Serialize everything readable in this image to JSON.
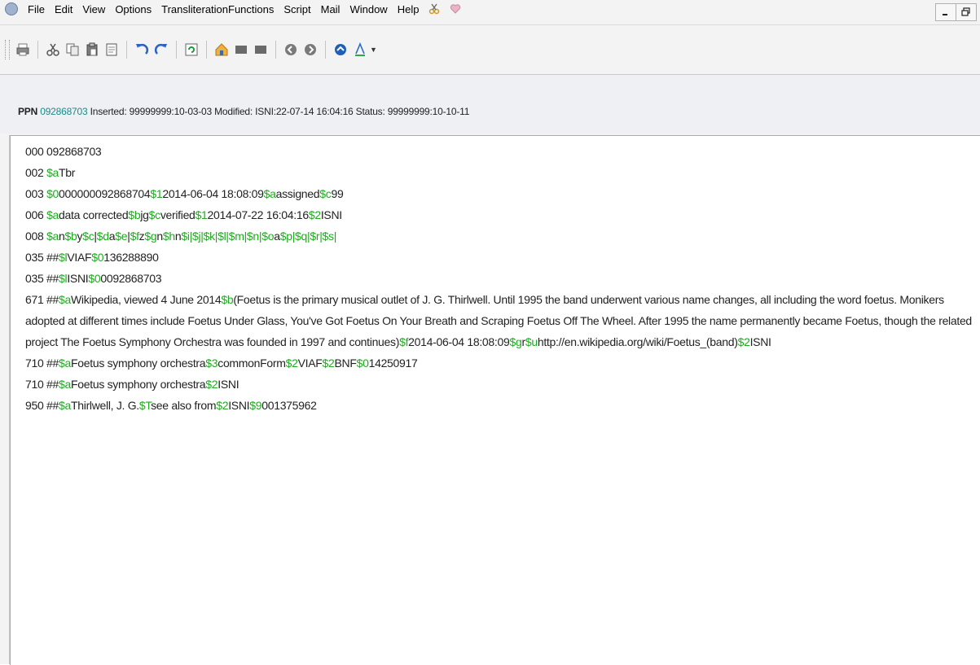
{
  "menubar": {
    "items": [
      "File",
      "Edit",
      "View",
      "Options",
      "TransliterationFunctions",
      "Script",
      "Mail",
      "Window",
      "Help"
    ]
  },
  "window_controls": [
    "minimize-icon",
    "restore-icon"
  ],
  "toolbar": {
    "icons": [
      "print-icon",
      "cut-icon",
      "copy-icon",
      "paste-icon",
      "document-icon",
      "undo-icon",
      "redo-icon",
      "refresh-icon",
      "home-icon",
      "block-icon",
      "block-icon",
      "back-icon",
      "forward-icon",
      "up-icon",
      "font-color-icon"
    ]
  },
  "header": {
    "ppn_label": "PPN",
    "ppn_value": "092868703",
    "rest": " Inserted: 99999999:10-03-03 Modified: ISNI:22-07-14 16:04:16 Status: 99999999:10-10-11"
  },
  "colors": {
    "subfield": "#1faa1f",
    "ppn": "#1c8a8a"
  },
  "record": {
    "lines": [
      {
        "segments": [
          {
            "t": "000 092868703",
            "c": "n"
          }
        ]
      },
      {
        "segments": [
          {
            "t": "002 ",
            "c": "n"
          },
          {
            "t": "$a",
            "c": "s"
          },
          {
            "t": "Tbr",
            "c": "n"
          }
        ]
      },
      {
        "segments": [
          {
            "t": "003 ",
            "c": "n"
          },
          {
            "t": "$0",
            "c": "s"
          },
          {
            "t": "000000092868704",
            "c": "n"
          },
          {
            "t": "$1",
            "c": "s"
          },
          {
            "t": "2014-06-04 18:08:09",
            "c": "n"
          },
          {
            "t": "$a",
            "c": "s"
          },
          {
            "t": "assigned",
            "c": "n"
          },
          {
            "t": "$c",
            "c": "s"
          },
          {
            "t": "99",
            "c": "n"
          }
        ]
      },
      {
        "segments": [
          {
            "t": "006 ",
            "c": "n"
          },
          {
            "t": "$a",
            "c": "s"
          },
          {
            "t": "data corrected",
            "c": "n"
          },
          {
            "t": "$b",
            "c": "s"
          },
          {
            "t": "jg",
            "c": "n"
          },
          {
            "t": "$c",
            "c": "s"
          },
          {
            "t": "verified",
            "c": "n"
          },
          {
            "t": "$1",
            "c": "s"
          },
          {
            "t": "2014-07-22 16:04:16",
            "c": "n"
          },
          {
            "t": "$2",
            "c": "s"
          },
          {
            "t": "ISNI",
            "c": "n"
          }
        ]
      },
      {
        "segments": [
          {
            "t": "008 ",
            "c": "n"
          },
          {
            "t": "$a",
            "c": "s"
          },
          {
            "t": "n",
            "c": "n"
          },
          {
            "t": "$b",
            "c": "s"
          },
          {
            "t": "y",
            "c": "n"
          },
          {
            "t": "$c",
            "c": "s"
          },
          {
            "t": "|",
            "c": "n"
          },
          {
            "t": "$d",
            "c": "s"
          },
          {
            "t": "a",
            "c": "n"
          },
          {
            "t": "$e",
            "c": "s"
          },
          {
            "t": "|",
            "c": "n"
          },
          {
            "t": "$f",
            "c": "s"
          },
          {
            "t": "z",
            "c": "n"
          },
          {
            "t": "$g",
            "c": "s"
          },
          {
            "t": "n",
            "c": "n"
          },
          {
            "t": "$h",
            "c": "s"
          },
          {
            "t": "n",
            "c": "n"
          },
          {
            "t": "$i|$j|$k|$l|$m|$n|",
            "c": "s"
          },
          {
            "t": "$o",
            "c": "s"
          },
          {
            "t": "a",
            "c": "n"
          },
          {
            "t": "$p|$q|$r|$s|",
            "c": "s"
          }
        ]
      },
      {
        "segments": [
          {
            "t": "035 ##",
            "c": "n"
          },
          {
            "t": "$l",
            "c": "s"
          },
          {
            "t": "VIAF",
            "c": "n"
          },
          {
            "t": "$0",
            "c": "s"
          },
          {
            "t": "136288890",
            "c": "n"
          }
        ]
      },
      {
        "segments": [
          {
            "t": "035 ##",
            "c": "n"
          },
          {
            "t": "$l",
            "c": "s"
          },
          {
            "t": "ISNI",
            "c": "n"
          },
          {
            "t": "$0",
            "c": "s"
          },
          {
            "t": "0092868703",
            "c": "n"
          }
        ]
      },
      {
        "wrap": true,
        "segments": [
          {
            "t": "671 ##",
            "c": "n"
          },
          {
            "t": "$a",
            "c": "s"
          },
          {
            "t": "Wikipedia, viewed 4 June 2014",
            "c": "n"
          },
          {
            "t": "$b",
            "c": "s"
          },
          {
            "t": "(Foetus is the primary musical outlet of J. G. Thirlwell. Until 1995 the band underwent various name changes, all including the word foetus. Monikers adopted at different times include Foetus Under Glass, You've Got Foetus On Your Breath and Scraping Foetus Off The Wheel. After 1995 the name permanently became Foetus, though the related project The Foetus Symphony Orchestra was founded in 1997 and continues)",
            "c": "n"
          },
          {
            "t": "$f",
            "c": "s"
          },
          {
            "t": "2014-06-04 18:08:09",
            "c": "n"
          },
          {
            "t": "$g",
            "c": "s"
          },
          {
            "t": "r",
            "c": "n"
          },
          {
            "t": "$u",
            "c": "s"
          },
          {
            "t": "http://en.wikipedia.org/wiki/Foetus_(band)",
            "c": "n"
          },
          {
            "t": "$2",
            "c": "s"
          },
          {
            "t": "ISNI",
            "c": "n"
          }
        ]
      },
      {
        "segments": [
          {
            "t": "710 ##",
            "c": "n"
          },
          {
            "t": "$a",
            "c": "s"
          },
          {
            "t": "Foetus symphony orchestra",
            "c": "n"
          },
          {
            "t": "$3",
            "c": "s"
          },
          {
            "t": "commonForm",
            "c": "n"
          },
          {
            "t": "$2",
            "c": "s"
          },
          {
            "t": "VIAF",
            "c": "n"
          },
          {
            "t": "$2",
            "c": "s"
          },
          {
            "t": "BNF",
            "c": "n"
          },
          {
            "t": "$0",
            "c": "s"
          },
          {
            "t": "14250917",
            "c": "n"
          }
        ]
      },
      {
        "segments": [
          {
            "t": "710 ##",
            "c": "n"
          },
          {
            "t": "$a",
            "c": "s"
          },
          {
            "t": "Foetus symphony orchestra",
            "c": "n"
          },
          {
            "t": "$2",
            "c": "s"
          },
          {
            "t": "ISNI",
            "c": "n"
          }
        ]
      },
      {
        "segments": [
          {
            "t": "950 ##",
            "c": "n"
          },
          {
            "t": "$a",
            "c": "s"
          },
          {
            "t": "Thirlwell, J. G.",
            "c": "n"
          },
          {
            "t": "$T",
            "c": "s"
          },
          {
            "t": "see also from",
            "c": "n"
          },
          {
            "t": "$2",
            "c": "s"
          },
          {
            "t": "ISNI",
            "c": "n"
          },
          {
            "t": "$9",
            "c": "s"
          },
          {
            "t": "001375962",
            "c": "n"
          }
        ]
      }
    ]
  }
}
